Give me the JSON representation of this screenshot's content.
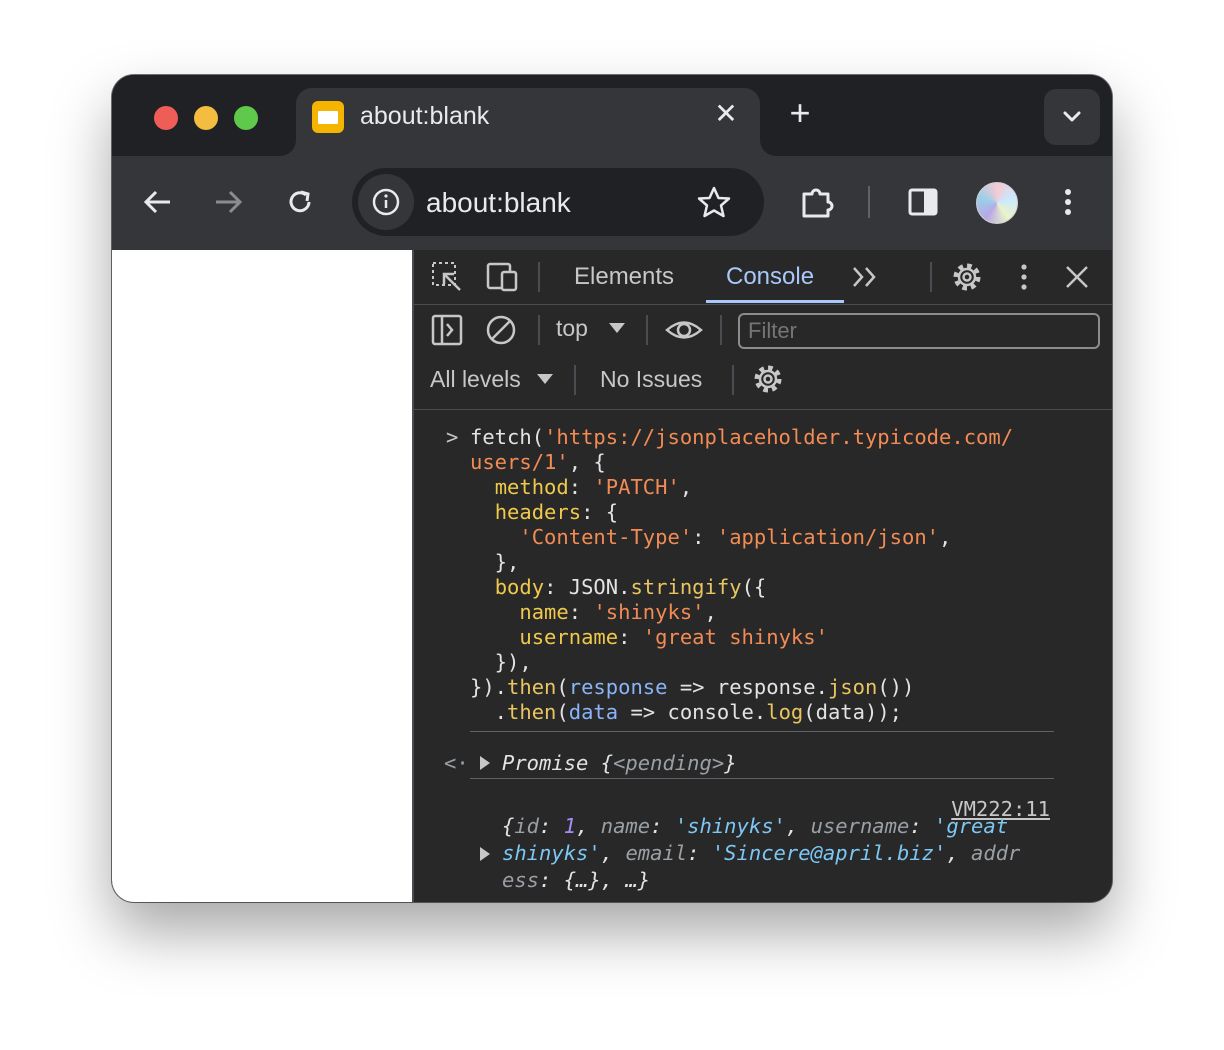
{
  "tab": {
    "title": "about:blank",
    "close_label": "✕"
  },
  "newtab_label": "+",
  "omnibox": {
    "url": "about:blank"
  },
  "devtools": {
    "tabs": [
      {
        "label": "Elements"
      },
      {
        "label": "Console",
        "active": true
      }
    ],
    "context": "top",
    "filter_placeholder": "Filter",
    "levels": "All levels",
    "issues": "No Issues"
  },
  "console": {
    "input_lines": [
      "fetch('https://jsonplaceholder.typicode.com/",
      "users/1', {",
      "  method: 'PATCH',",
      "  headers: {",
      "    'Content-Type': 'application/json',",
      "  },",
      "  body: JSON.stringify({",
      "    name: 'shinyks',",
      "    username: 'great shinyks'",
      "  }),",
      "}).then(response => response.json())",
      "  .then(data => console.log(data));"
    ],
    "result": {
      "label": "Promise",
      "state": "<pending>"
    },
    "log_source": "VM222:11",
    "log_object": {
      "id": "1",
      "name": "'shinyks'",
      "username_part1": "'great",
      "username_part2": "shinyks'",
      "email": "'Sincere@april.biz'",
      "address_part1": "addr",
      "address_part2": "ess",
      "address_value": "{…}",
      "more": "…"
    }
  },
  "colors": {
    "accent": "#a8c7fa",
    "string": "#f28b54",
    "keyword": "#f0c94b"
  }
}
